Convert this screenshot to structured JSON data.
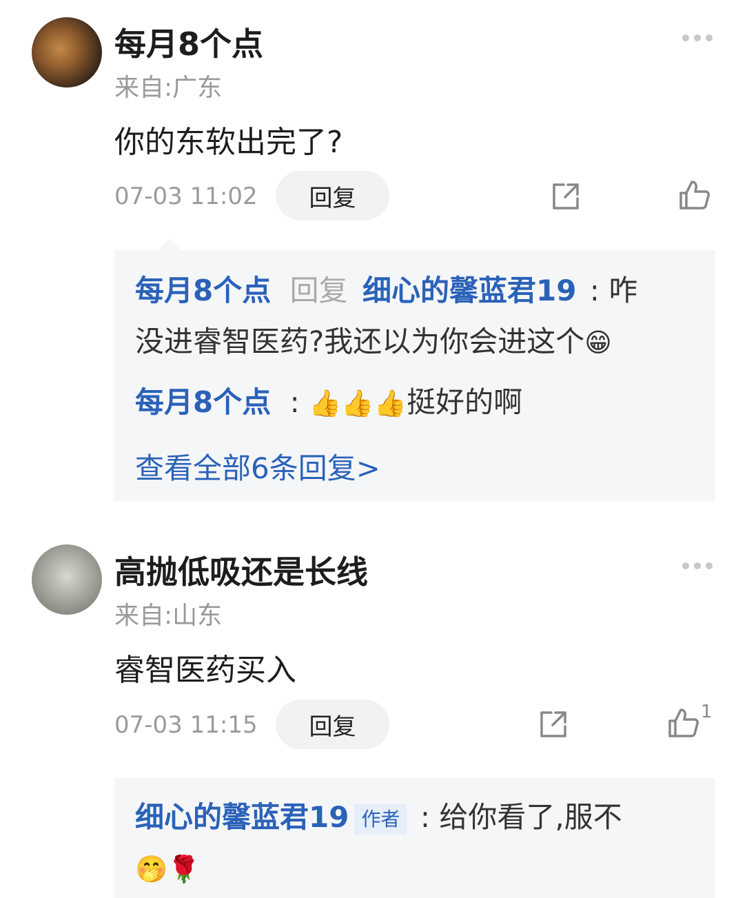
{
  "comments": [
    {
      "username": "每月8个点",
      "location": "来自:广东",
      "content": "你的东软出完了?",
      "time": "07-03 11:02",
      "reply_label": "回复",
      "likes": "",
      "replies": [
        {
          "user": "每月8个点",
          "mid": "回复",
          "target": "细心的馨蓝君19",
          "sep": ":",
          "text1": "咋",
          "text2": "没进睿智医药?我还以为你会进这个",
          "emoji": "😁"
        },
        {
          "user": "每月8个点",
          "sep": ":",
          "emoji": "👍👍👍",
          "text": "挺好的啊"
        }
      ],
      "view_all": "查看全部6条回复>"
    },
    {
      "username": "高抛低吸还是长线",
      "location": "来自:山东",
      "content": "睿智医药买入",
      "time": "07-03 11:15",
      "reply_label": "回复",
      "likes": "1",
      "replies": [
        {
          "user": "细心的馨蓝君19",
          "tag": "作者",
          "sep": ":",
          "text1": "给你看了,服不",
          "emoji": "🤭🌹"
        }
      ]
    }
  ],
  "icons": {
    "more": "more-dots-icon",
    "share": "share-icon",
    "like": "thumbs-up-icon"
  },
  "colors": {
    "link": "#2a62b8",
    "reply_bg": "#f5f6f8",
    "meta": "#999999"
  }
}
